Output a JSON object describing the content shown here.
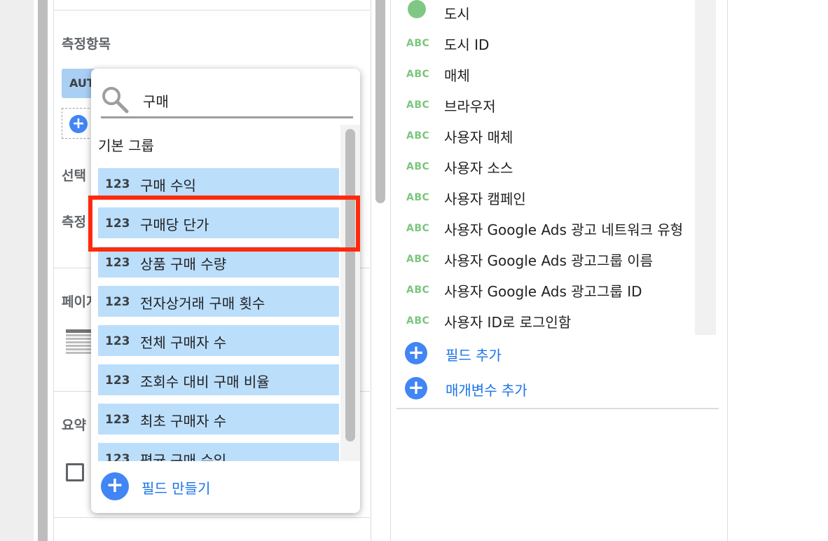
{
  "left_panel": {
    "metrics_title": "측정항목",
    "auto_chip": "AUT",
    "add_icon": "plus-circle-icon",
    "selection_label": "선택",
    "measure_label": "측정",
    "page_label": "페이지",
    "summary_label": "요약"
  },
  "popup": {
    "search_value": "구매",
    "search_icon": "search-icon",
    "group_label": "기본 그룹",
    "items": [
      {
        "type": "123",
        "label": "구매 수익"
      },
      {
        "type": "123",
        "label": "구매당 단가"
      },
      {
        "type": "123",
        "label": "상품 구매 수량"
      },
      {
        "type": "123",
        "label": "전자상거래 구매 횟수"
      },
      {
        "type": "123",
        "label": "전체 구매자 수"
      },
      {
        "type": "123",
        "label": "조회수 대비 구매 비율"
      },
      {
        "type": "123",
        "label": "최초 구매자 수"
      },
      {
        "type": "123",
        "label": "평균 구매 수익"
      }
    ],
    "create_field": "필드 만들기"
  },
  "fields": {
    "items": [
      {
        "type": "globe",
        "label": "도시"
      },
      {
        "type": "ABC",
        "label": "도시 ID"
      },
      {
        "type": "ABC",
        "label": "매체"
      },
      {
        "type": "ABC",
        "label": "브라우저"
      },
      {
        "type": "ABC",
        "label": "사용자 매체"
      },
      {
        "type": "ABC",
        "label": "사용자 소스"
      },
      {
        "type": "ABC",
        "label": "사용자 캠페인"
      },
      {
        "type": "ABC",
        "label": "사용자 Google Ads 광고 네트워크 유형"
      },
      {
        "type": "ABC",
        "label": "사용자 Google Ads 광고그룹 이름"
      },
      {
        "type": "ABC",
        "label": "사용자 Google Ads 광고그룹 ID"
      },
      {
        "type": "ABC",
        "label": "사용자 ID로 로그인함"
      }
    ],
    "add_field": "필드 추가",
    "add_parameter": "매개변수 추가"
  },
  "colors": {
    "accent": "#4285f4",
    "item_bg": "#bbdefb",
    "highlight": "#ff2a0d",
    "abc": "#7bc67e"
  }
}
